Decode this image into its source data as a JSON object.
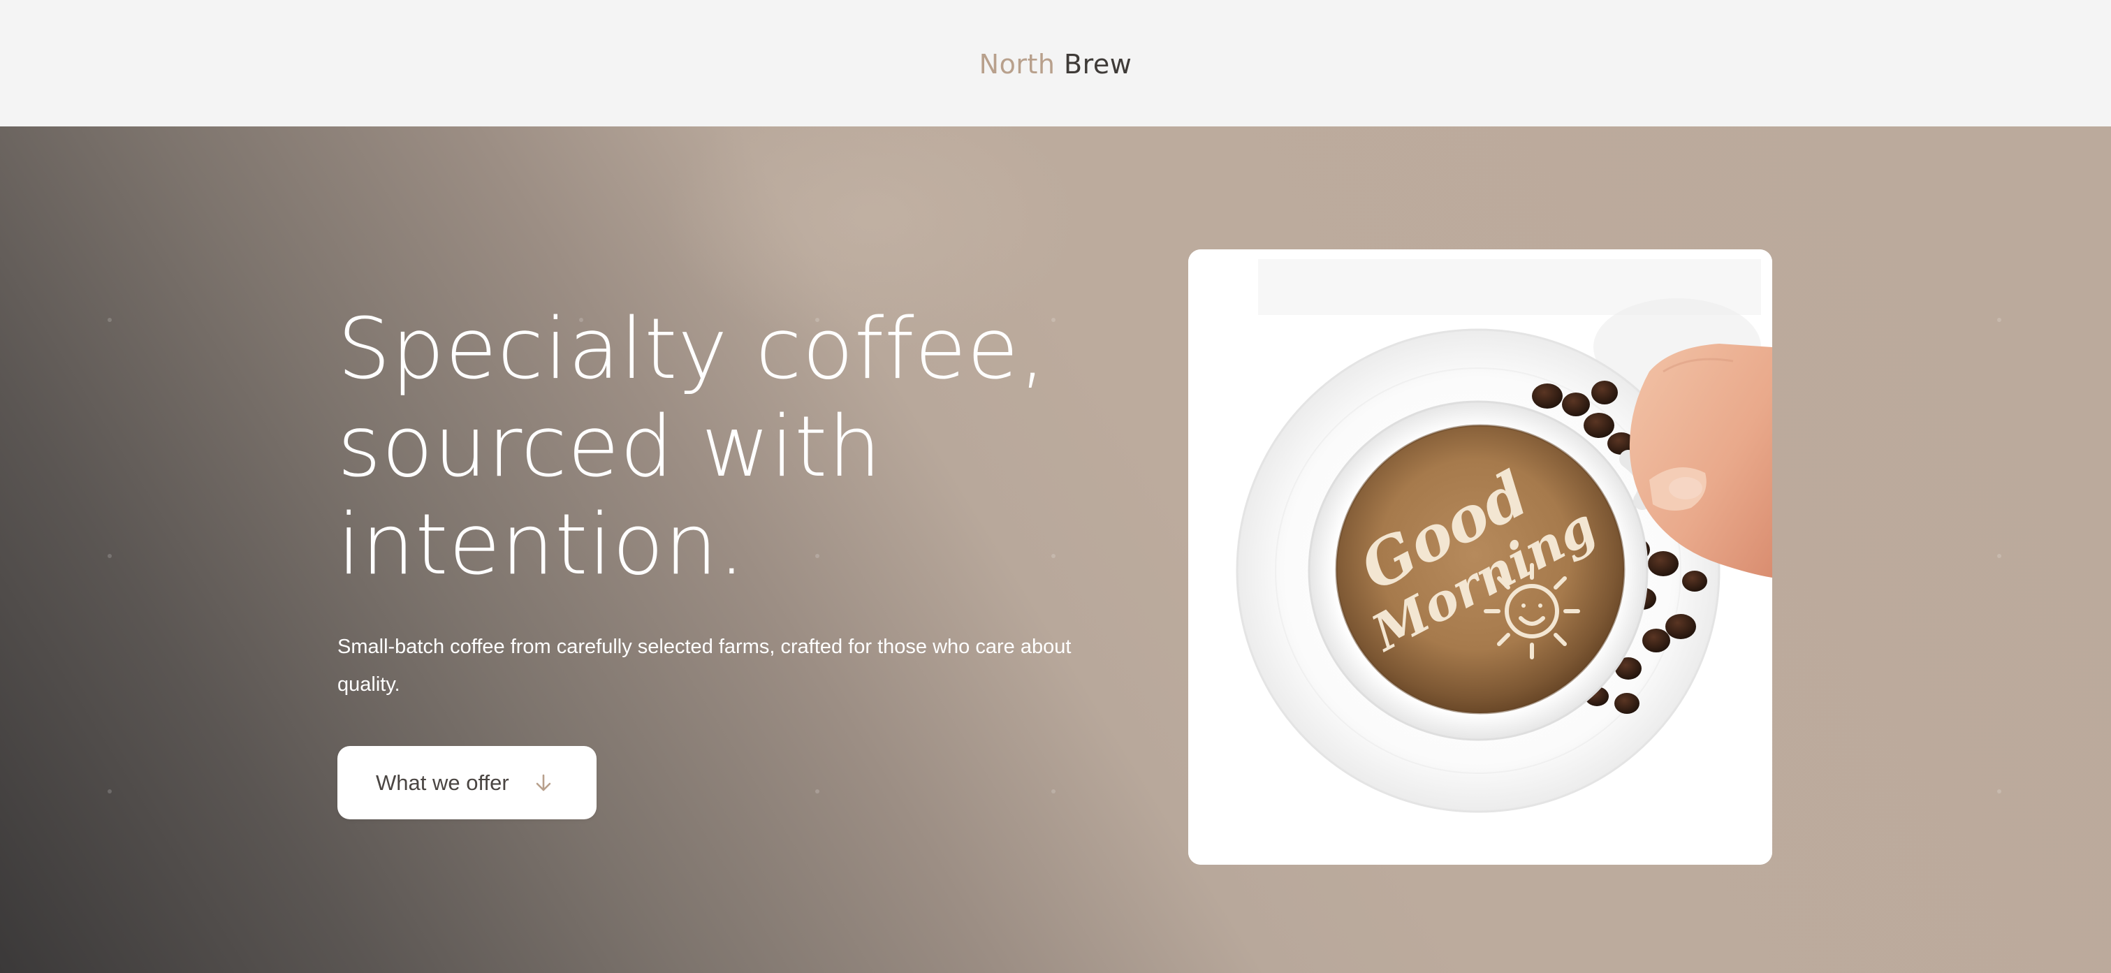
{
  "header": {
    "logo_primary": "North",
    "logo_secondary": "Brew"
  },
  "hero": {
    "headline_lines": [
      "Specialty coffee,",
      "sourced with",
      "intention."
    ],
    "subtitle": "Small-batch coffee from carefully selected farms, crafted for those who care about quality.",
    "cta_label": "What we offer",
    "cta_icon": "arrow-down-icon"
  },
  "image": {
    "latte_art_text_1": "Good",
    "latte_art_text_2": "Morning",
    "alt_icon": "coffee-cup-photo"
  },
  "colors": {
    "accent": "#b8a08c",
    "logo_text": "#3f3b38",
    "header_bg": "#f4f4f4",
    "hero_dark": "#3b3939",
    "hero_light": "#bbaa9c",
    "button_bg": "#ffffff",
    "button_text": "#4a4542"
  }
}
